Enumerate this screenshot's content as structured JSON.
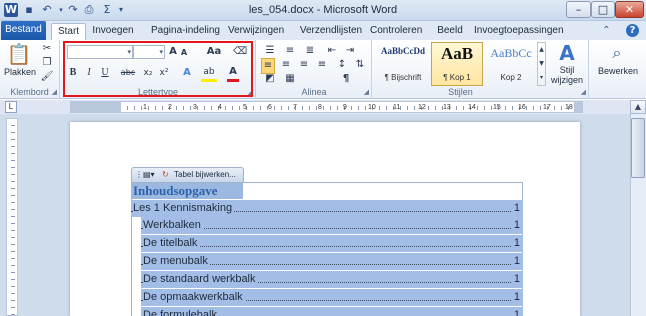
{
  "window": {
    "title": "les_054.docx - Microsoft Word",
    "quick_access": [
      "word-logo-icon",
      "save-icon",
      "undo-icon",
      "redo-icon",
      "print-preview-icon",
      "sum-icon",
      "customize-icon"
    ],
    "controls": {
      "minimize": "–",
      "maximize": "□",
      "close": "✕"
    }
  },
  "tabs": {
    "file": "Bestand",
    "items": [
      "Start",
      "Invoegen",
      "Pagina-indeling",
      "Verwijzingen",
      "Verzendlijsten",
      "Controleren",
      "Beeld",
      "Invoegtoepassingen"
    ],
    "active": "Start"
  },
  "ribbon": {
    "clipboard": {
      "paste_label": "Plakken",
      "group_label": "Klembord"
    },
    "font": {
      "font_name": "",
      "font_size": "",
      "grow": "A",
      "shrink": "A",
      "change_case": "Aa",
      "bold": "B",
      "italic": "I",
      "underline": "U",
      "strike": "abc",
      "subscript": "x₂",
      "superscript": "x²",
      "text_effects": "A",
      "highlight": "ab",
      "font_color": "A",
      "group_label": "Lettertype"
    },
    "paragraph": {
      "group_label": "Alinea",
      "pilcrow": "¶"
    },
    "styles": {
      "group_label": "Stijlen",
      "items": [
        {
          "sample": "AaBbCcDd",
          "name": "¶ Bijschrift"
        },
        {
          "sample": "AaB",
          "name": "¶ Kop 1"
        },
        {
          "sample": "AaBbCc",
          "name": "Kop 2"
        }
      ],
      "change_styles": "Stijl wijzigen"
    },
    "editing": {
      "label": "Bewerken"
    }
  },
  "ruler": {
    "numbers": [
      "1",
      "2",
      "1",
      "2",
      "3",
      "4",
      "5",
      "6",
      "7",
      "8",
      "9",
      "10",
      "11",
      "12",
      "13",
      "14",
      "15",
      "16",
      "17",
      "18"
    ],
    "corner": "L"
  },
  "document": {
    "toc_toolbar_label": "Tabel bijwerken...",
    "toc_title": "Inhoudsopgave",
    "toc_entries": [
      {
        "text": "Les 1 Kennismaking",
        "page": "1",
        "level": 1
      },
      {
        "text": "Werkbalken",
        "page": "1",
        "level": 2
      },
      {
        "text": "De titelbalk",
        "page": "1",
        "level": 2
      },
      {
        "text": "De menubalk",
        "page": "1",
        "level": 2
      },
      {
        "text": "De standaard werkbalk",
        "page": "1",
        "level": 2
      },
      {
        "text": "De opmaakwerkbalk",
        "page": "1",
        "level": 2
      },
      {
        "text": "De formulebalk",
        "page": "1",
        "level": 2
      }
    ]
  },
  "colors": {
    "accent": "#2c6cc0",
    "highlight_box": "#e0171d",
    "toc_selection": "#a3bee6"
  }
}
